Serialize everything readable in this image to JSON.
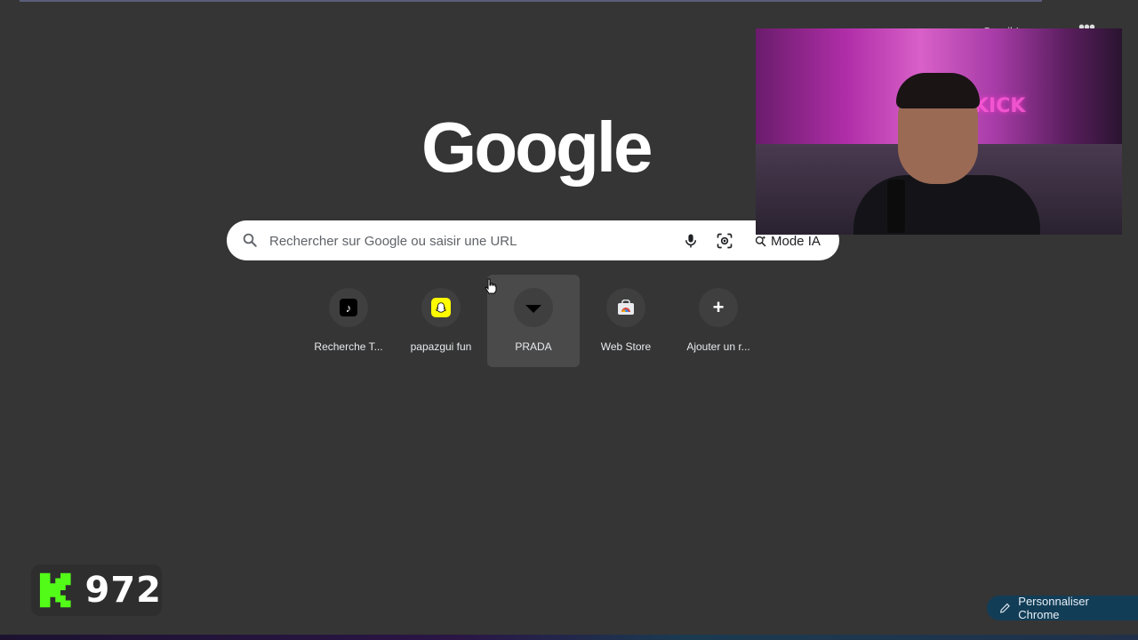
{
  "window": {
    "top_right_text": "Gmail Images",
    "menu_icon": "apps-dots-icon"
  },
  "logo": {
    "text": "Google"
  },
  "search": {
    "placeholder": "Rechercher sur Google ou saisir une URL",
    "value": "",
    "mode_ia_label": "Mode IA",
    "icons": [
      "search-icon",
      "mic-icon",
      "lens-icon",
      "ai-search-icon"
    ]
  },
  "shortcuts": [
    {
      "label": "Recherche T...",
      "icon": "tiktok-icon"
    },
    {
      "label": "papazgui fun",
      "icon": "snapchat-icon"
    },
    {
      "label": "PRADA",
      "icon": "prada-triangle-icon"
    },
    {
      "label": "Web Store",
      "icon": "web-store-icon"
    },
    {
      "label": "Ajouter un r...",
      "icon": "plus-icon"
    }
  ],
  "overlay": {
    "kick_count": "972",
    "webcam_neon_text": "KICK"
  },
  "customize": {
    "label": "Personnaliser Chrome",
    "icon": "pencil-icon"
  },
  "colors": {
    "background": "#353535",
    "searchbar": "#ffffff",
    "kick_green": "#53fc18",
    "customize_bg": "#123d57"
  }
}
